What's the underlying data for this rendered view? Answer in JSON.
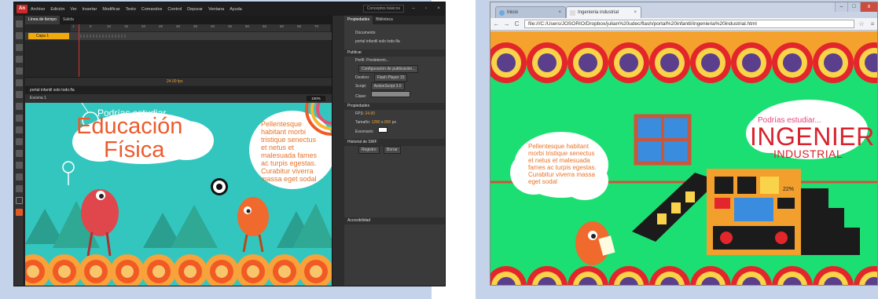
{
  "left_window": {
    "menu": [
      "Archivo",
      "Edición",
      "Ver",
      "Insertar",
      "Modificar",
      "Texto",
      "Comandos",
      "Control",
      "Depurar",
      "Ventana",
      "Ayuda"
    ],
    "logo": "An",
    "workspace": "Conceptos básicos",
    "timeline_tabs": [
      "Línea de tiempo",
      "Salida"
    ],
    "ruler": [
      "1",
      "5",
      "10",
      "15",
      "20",
      "25",
      "30",
      "35",
      "40",
      "45",
      "50",
      "55",
      "60",
      "65",
      "70",
      "75"
    ],
    "layer_name": "Capa 1",
    "fps_readout": "24.00 fps",
    "doc_tab": "portal infantil solo todo.fla",
    "scene": "Escena 1",
    "zoom": "100%",
    "stage": {
      "small_title": "Podrías estudiar...",
      "title_line1": "Educación",
      "title_line2": "Física",
      "bubble_text": "Pellentesque habitant morbi tristique senectus et netus et malesuada fames ac turpis egestas. Curabitur viverra massa eget sodal"
    },
    "properties": {
      "tabs": [
        "Propiedades",
        "Biblioteca"
      ],
      "doc_label": "Documento",
      "doc_name": "portal infantil solo todo.fla",
      "publish_section": "Publicar",
      "profile_label": "Perfil:",
      "profile_value": "Predetermi...",
      "publish_settings": "Configuración de publicación...",
      "target_label": "Destino:",
      "target_value": "Flash Player 15",
      "script_label": "Script:",
      "script_value": "ActionScript 3.0",
      "class_label": "Clase:",
      "props_section": "Propiedades",
      "fps_label": "FPS:",
      "fps_value": "24.00",
      "size_label": "Tamaño:",
      "width_value": "1280",
      "x_label": "x",
      "height_value": "800",
      "px_label": "px",
      "stage_label": "Escenario:",
      "swf_section": "Historial de SWF",
      "registro_btn": "Registro",
      "borrar_btn": "Borrar",
      "access_section": "Accesibilidad"
    }
  },
  "right_window": {
    "tabs": [
      {
        "label": "Inicio"
      },
      {
        "label": "Ingenieria industrial"
      }
    ],
    "url": "file:///C:/Users/JOSORIO/Dropbox/julian%20udec/flash/portal%20infantil/ingenieria%20industrial.html",
    "window_buttons": [
      "–",
      "□",
      "x"
    ],
    "viewport": {
      "small_title": "Podrías estudiar...",
      "big_title": "INGENIER",
      "subtitle": "INDUSTRIAL",
      "bubble_text": "Pellentesque habitant morbi tristique senectus et netus et malesuada fames ac turpis egestas. Curabitur viverra massa eget sodal",
      "machine_display": "22%"
    }
  },
  "colors": {
    "frame": "#c5d3ea",
    "stage_teal": "#33c6bf",
    "browser_green": "#1cdf73",
    "title_orange": "#ec5b2d",
    "title_red": "#d8222c",
    "layer_orange": "#f2a90c"
  }
}
